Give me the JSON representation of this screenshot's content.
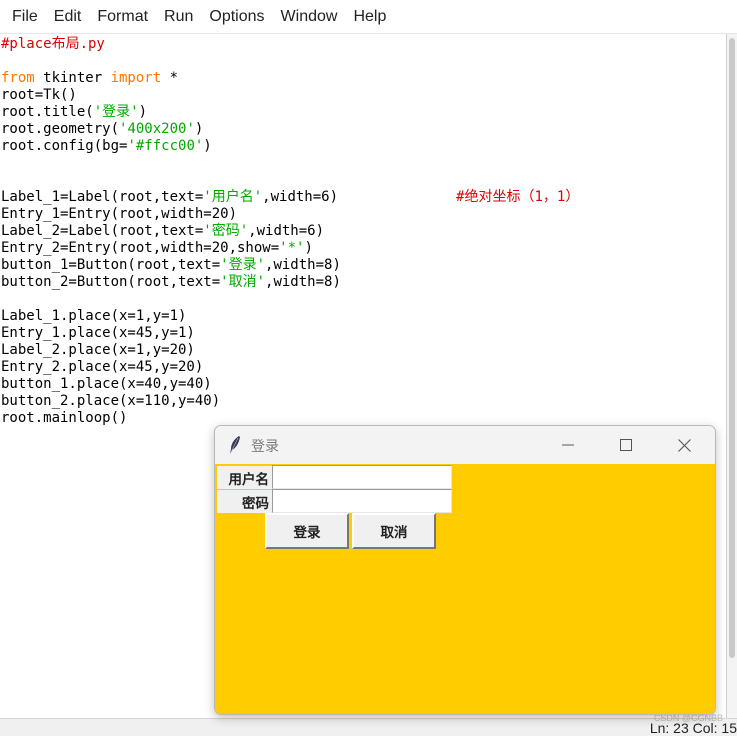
{
  "menu": [
    "File",
    "Edit",
    "Format",
    "Run",
    "Options",
    "Window",
    "Help"
  ],
  "code_lines": [
    [
      {
        "t": "#place布局.py",
        "c": "cmt"
      }
    ],
    [],
    [
      {
        "t": "from",
        "c": "kw"
      },
      {
        "t": " tkinter "
      },
      {
        "t": "import",
        "c": "kw"
      },
      {
        "t": " *"
      }
    ],
    [
      {
        "t": "root=Tk()"
      }
    ],
    [
      {
        "t": "root.title("
      },
      {
        "t": "'登录'",
        "c": "str"
      },
      {
        "t": ")"
      }
    ],
    [
      {
        "t": "root.geometry("
      },
      {
        "t": "'400x200'",
        "c": "str"
      },
      {
        "t": ")"
      }
    ],
    [
      {
        "t": "root.config(bg="
      },
      {
        "t": "'#ffcc00'",
        "c": "str"
      },
      {
        "t": ")"
      }
    ],
    [],
    [],
    [
      {
        "t": "Label_1=Label(root,text="
      },
      {
        "t": "'用户名'",
        "c": "str"
      },
      {
        "t": ",width=6)              "
      },
      {
        "t": "#绝对坐标（1，1）",
        "c": "cmt"
      }
    ],
    [
      {
        "t": "Entry_1=Entry(root,width=20)"
      }
    ],
    [
      {
        "t": "Label_2=Label(root,text="
      },
      {
        "t": "'密码'",
        "c": "str"
      },
      {
        "t": ",width=6)"
      }
    ],
    [
      {
        "t": "Entry_2=Entry(root,width=20,show="
      },
      {
        "t": "'*'",
        "c": "str"
      },
      {
        "t": ")"
      }
    ],
    [
      {
        "t": "button_1=Button(root,text="
      },
      {
        "t": "'登录'",
        "c": "str"
      },
      {
        "t": ",width=8)"
      }
    ],
    [
      {
        "t": "button_2=Button(root,text="
      },
      {
        "t": "'取消'",
        "c": "str"
      },
      {
        "t": ",width=8)"
      }
    ],
    [],
    [
      {
        "t": "Label_1.place(x=1,y=1)"
      }
    ],
    [
      {
        "t": "Entry_1.place(x=45,y=1)"
      }
    ],
    [
      {
        "t": "Label_2.place(x=1,y=20)"
      }
    ],
    [
      {
        "t": "Entry_2.place(x=45,y=20)"
      }
    ],
    [
      {
        "t": "button_1.place(x=40,y=40)"
      }
    ],
    [
      {
        "t": "button_2.place(x=110,y=40)"
      }
    ],
    [
      {
        "t": "root.mainloop()"
      }
    ]
  ],
  "status": "Ln: 23   Col: 15",
  "watermark": "CSDN @CGNBB",
  "colors": {
    "keyword": "#ff7700",
    "string": "#00aa00",
    "comment": "#dd0000",
    "tk_bg": "#ffcc00"
  },
  "tk_window": {
    "title": "登录",
    "label_username": "用户名",
    "label_password": "密码",
    "entry_username_value": "",
    "entry_password_value": "",
    "login_button": "登录",
    "cancel_button": "取消"
  }
}
